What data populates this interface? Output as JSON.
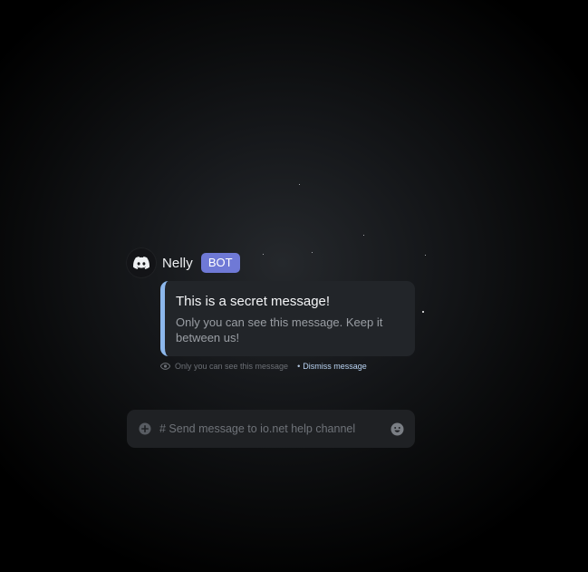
{
  "message": {
    "avatar_icon": "discord-logo-icon",
    "username": "Nelly",
    "badge": "BOT",
    "title": "This is a secret message!",
    "body": "Only you can see this message. Keep it between us!"
  },
  "notice": {
    "eye_icon": "eye-icon",
    "text": "Only you can see this message",
    "separator": "•",
    "dismiss_label": "Dismiss message"
  },
  "composer": {
    "add_icon": "plus-circle-icon",
    "placeholder": "# Send message to io.net help channel",
    "emoji_icon": "smiley-icon"
  },
  "colors": {
    "badge": "#6f79d6",
    "accent_bar": "#8cb7eb",
    "dismiss_link": "#b9d3f2"
  }
}
